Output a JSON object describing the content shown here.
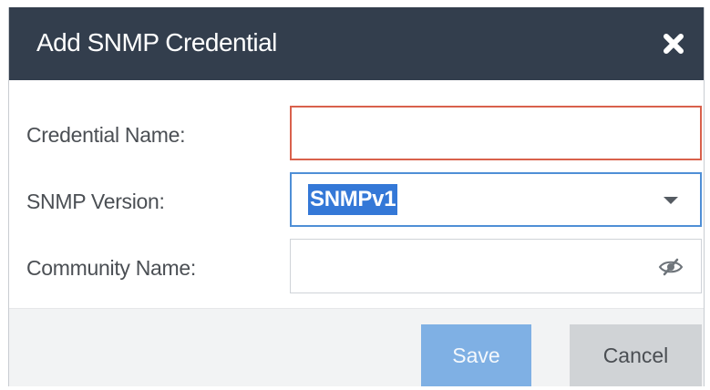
{
  "dialog": {
    "title": "Add SNMP Credential",
    "close_icon": "close-icon"
  },
  "form": {
    "credential_name": {
      "label": "Credential Name:",
      "value": ""
    },
    "snmp_version": {
      "label": "SNMP Version:",
      "value": "SNMPv1"
    },
    "community_name": {
      "label": "Community Name:",
      "value": "",
      "icon": "eye-hidden-icon"
    }
  },
  "footer": {
    "save_label": "Save",
    "cancel_label": "Cancel"
  },
  "colors": {
    "header_background": "#333e4d",
    "error_border": "#d9614c",
    "focus_border": "#4f8fd6",
    "selection": "#3478d7",
    "save_button": "#7fb0e4",
    "cancel_button": "#d0d3d6"
  }
}
